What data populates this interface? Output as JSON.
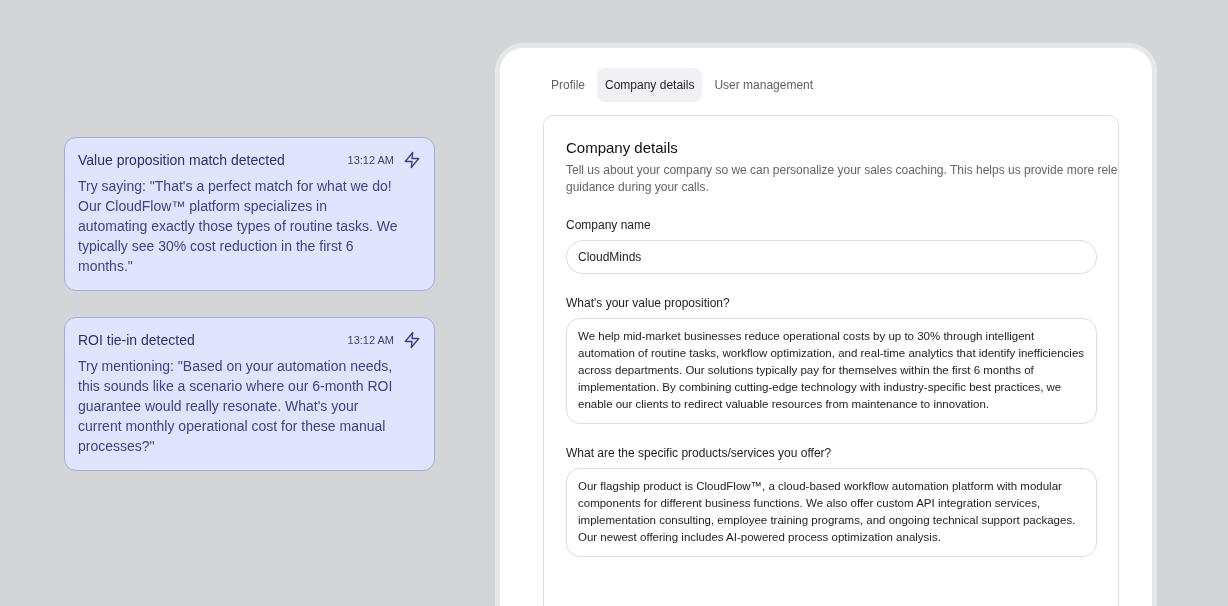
{
  "suggestions": [
    {
      "title": "Value proposition match detected",
      "time": "13:12 AM",
      "text": "Try saying: \"That's a perfect match for what we do! Our CloudFlow™ platform specializes in automating exactly those types of routine tasks. We typically see 30% cost reduction in the first 6 months.\""
    },
    {
      "title": "ROI tie-in detected",
      "time": "13:12 AM",
      "text": "Try mentioning: \"Based on your automation needs, this sounds like a scenario where our 6-month ROI guarantee would really resonate. What's your current monthly operational cost for these manual processes?\""
    }
  ],
  "tabs": [
    {
      "label": "Profile",
      "selected": false
    },
    {
      "label": "Company details",
      "selected": true
    },
    {
      "label": "User management",
      "selected": false
    }
  ],
  "section": {
    "title": "Company details",
    "description_lines": [
      "Tell us about your company so we can personalize your sales coaching. This helps us provide more rele",
      "guidance during your calls."
    ],
    "fields": [
      {
        "kind": "input",
        "label": "Company name",
        "value": "CloudMinds"
      },
      {
        "kind": "textarea",
        "label": "What's your value proposition?",
        "value": "We help mid-market businesses reduce operational costs by up to 30% through intelligent automation of routine tasks, workflow optimization, and real-time analytics that identify inefficiencies across departments. Our solutions typically pay for themselves within the first 6 months of implementation. By combining cutting-edge technology with industry-specific best practices, we enable our clients to redirect valuable resources from maintenance to innovation."
      },
      {
        "kind": "textarea",
        "label": "What are the specific products/services you offer?",
        "value": "Our flagship product is CloudFlow™, a cloud-based workflow automation platform with modular components for different business functions. We also offer custom API integration services, implementation consulting, employee training programs, and ongoing technical support packages. Our newest offering includes AI-powered process optimization analysis."
      }
    ]
  }
}
